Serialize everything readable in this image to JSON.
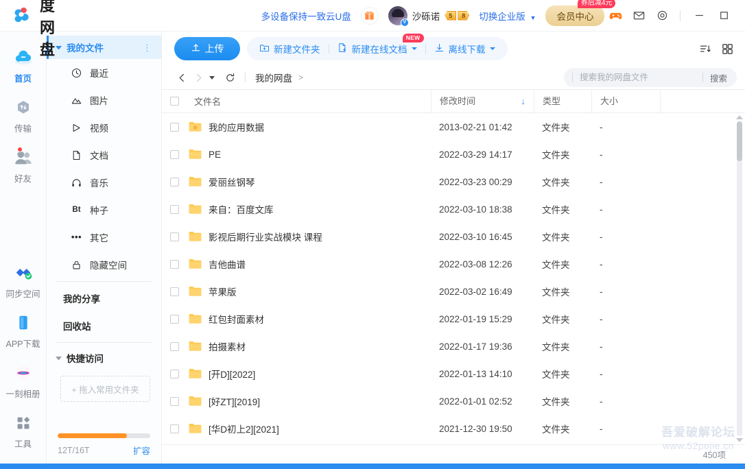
{
  "app": {
    "brand_title": "百度网盘"
  },
  "header": {
    "promo_link": "多设备保持一致云U盘",
    "gift_icon": "gift-icon",
    "username": "沙砾诺",
    "vip_mark": "V",
    "level_badges": [
      "5",
      "8"
    ],
    "switch_enterprise": "切换企业版",
    "vip_center": "会员中心",
    "vip_badge": "券后减4元",
    "icons": [
      "game-controller-icon",
      "mail-icon",
      "settings-icon"
    ],
    "window": {
      "minimize": "—",
      "maximize": "□",
      "close": "✕"
    }
  },
  "rail": {
    "items": [
      {
        "label": "首页",
        "icon": "cloud-icon",
        "active": true,
        "dot": false
      },
      {
        "label": "传输",
        "icon": "transfer-icon",
        "active": false,
        "dot": false
      },
      {
        "label": "好友",
        "icon": "friends-icon",
        "active": false,
        "dot": true
      }
    ],
    "bottom_items": [
      {
        "label": "同步空间",
        "icon": "sync-space-icon"
      },
      {
        "label": "APP下载",
        "icon": "phone-download-icon"
      },
      {
        "label": "一刻相册",
        "icon": "photo-album-icon"
      },
      {
        "label": "工具",
        "icon": "tools-icon"
      }
    ]
  },
  "sidebar": {
    "header": {
      "label": "我的文件",
      "menu_icon": "more-vertical-icon"
    },
    "items": [
      {
        "label": "最近",
        "icon": "clock-icon"
      },
      {
        "label": "图片",
        "icon": "image-icon"
      },
      {
        "label": "视频",
        "icon": "play-icon"
      },
      {
        "label": "文档",
        "icon": "document-icon"
      },
      {
        "label": "音乐",
        "icon": "headphone-icon"
      },
      {
        "label": "种子",
        "icon": "bt-icon"
      },
      {
        "label": "其它",
        "icon": "ellipsis-icon"
      },
      {
        "label": "隐藏空间",
        "icon": "lock-icon"
      }
    ],
    "plain_items": [
      {
        "label": "我的分享"
      },
      {
        "label": "回收站"
      }
    ],
    "quick_access": {
      "label": "快捷访问",
      "dropzone": "+ 拖入常用文件夹"
    },
    "storage": {
      "used_text": "12T/16T",
      "percent": 75,
      "expand_label": "扩容",
      "bar_color": "#ff9326"
    }
  },
  "toolbar": {
    "upload_label": "上传",
    "upload_icon": "upload-icon",
    "new_folder": "新建文件夹",
    "new_folder_icon": "folder-plus-icon",
    "new_doc": "新建在线文档",
    "new_doc_icon": "file-plus-icon",
    "new_doc_badge": "NEW",
    "offline_download": "离线下载",
    "offline_icon": "download-icon",
    "sort_icon": "sort-desc-icon",
    "grid_icon": "grid-view-icon"
  },
  "breadcrumb": {
    "back_icon": "chevron-left-icon",
    "forward_icon": "chevron-right-icon",
    "history_icon": "chevron-down-icon",
    "refresh_icon": "refresh-icon",
    "path": "我的网盘",
    "separator": ">"
  },
  "search": {
    "placeholder": "搜索我的网盘文件",
    "button_label": "搜索",
    "value": ""
  },
  "table": {
    "columns": [
      "文件名",
      "修改时间",
      "类型",
      "大小"
    ],
    "sort_column": "修改时间",
    "sort_direction": "desc",
    "sort_arrow": "↓",
    "rows": [
      {
        "name": "我的应用数据",
        "time": "2013-02-21 01:42",
        "type": "文件夹",
        "size": "-",
        "icon": "app-folder-icon"
      },
      {
        "name": "PE",
        "time": "2022-03-29 14:17",
        "type": "文件夹",
        "size": "-",
        "icon": "folder-icon"
      },
      {
        "name": "爱丽丝钢琴",
        "time": "2022-03-23 00:29",
        "type": "文件夹",
        "size": "-",
        "icon": "folder-icon"
      },
      {
        "name": "来自：百度文库",
        "time": "2022-03-10 18:38",
        "type": "文件夹",
        "size": "-",
        "icon": "folder-icon"
      },
      {
        "name": "影视后期行业实战模块 课程",
        "time": "2022-03-10 16:45",
        "type": "文件夹",
        "size": "-",
        "icon": "folder-icon"
      },
      {
        "name": "吉他曲谱",
        "time": "2022-03-08 12:26",
        "type": "文件夹",
        "size": "-",
        "icon": "folder-icon"
      },
      {
        "name": "苹果版",
        "time": "2022-03-02 16:49",
        "type": "文件夹",
        "size": "-",
        "icon": "folder-icon"
      },
      {
        "name": "红包封面素材",
        "time": "2022-01-19 15:29",
        "type": "文件夹",
        "size": "-",
        "icon": "folder-icon"
      },
      {
        "name": "拍摄素材",
        "time": "2022-01-17 19:36",
        "type": "文件夹",
        "size": "-",
        "icon": "folder-icon"
      },
      {
        "name": "[开D][2022]",
        "time": "2022-01-13 14:10",
        "type": "文件夹",
        "size": "-",
        "icon": "folder-icon"
      },
      {
        "name": "[好ZT][2019]",
        "time": "2022-01-01 02:52",
        "type": "文件夹",
        "size": "-",
        "icon": "folder-icon"
      },
      {
        "name": "[华D初上2][2021]",
        "time": "2021-12-30 19:50",
        "type": "文件夹",
        "size": "-",
        "icon": "folder-icon"
      }
    ]
  },
  "footer": {
    "item_count": "450项"
  },
  "watermark": {
    "line1": "吾爱破解论坛",
    "line2": "www.52pojie.cn"
  },
  "colors": {
    "accent": "#2b8cf0",
    "link": "#2b6fe8",
    "folder": "#ffc94d",
    "badge_red": "#ff3b5c",
    "vip_gold": "#eccf93",
    "storage_orange": "#ff9326"
  }
}
